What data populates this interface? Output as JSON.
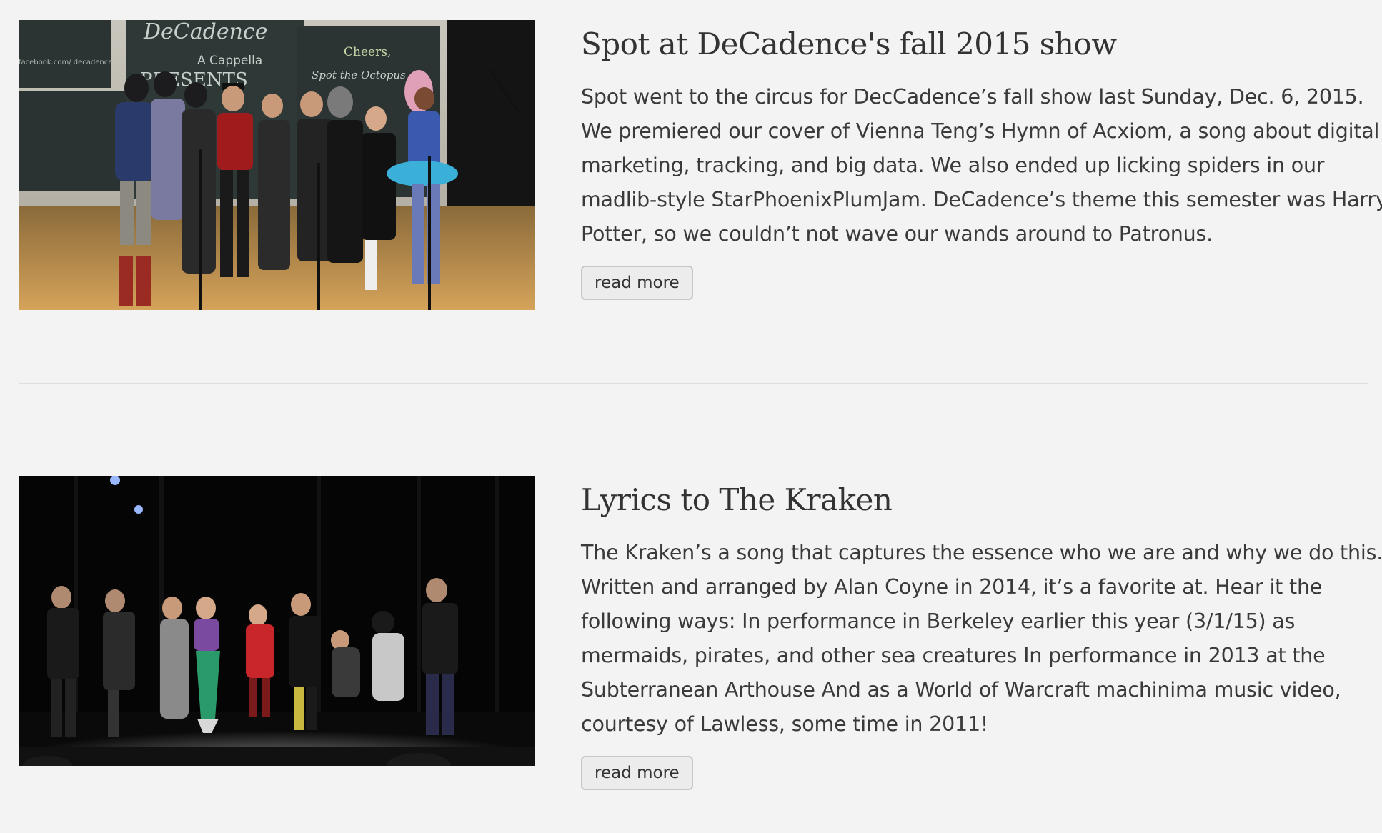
{
  "posts": [
    {
      "title": "Spot at DeCadence's fall 2015 show",
      "body": "Spot went to the circus for DecCadence’s fall show last Sunday, Dec. 6, 2015. We premiered our cover of Vienna Teng’s Hymn of Acxiom, a song about digital marketing, tracking, and big data. We also ended up licking spiders in our madlib-style StarPhoenixPlumJam. DeCadence’s theme this semester was Harry Potter, so we couldn’t not wave our wands around to Patronus.",
      "read_more": "read more",
      "image_text": {
        "board_title": "DeCadence",
        "board_sub": "A Cappella",
        "board_presents": "PRESENTS",
        "board_right_1": "Cheers,",
        "board_right_2": "Spot the Octopus",
        "board_left": "facebook.com/ decadence"
      }
    },
    {
      "title": "Lyrics to The Kraken",
      "body": "The Kraken’s a song that captures the essence who we are and why we do this. Written and arranged by Alan Coyne in 2014, it’s a favorite at. Hear it the following ways: In performance in Berkeley earlier this year (3/1/15) as mermaids, pirates, and other sea creatures In performance in 2013 at the Subterranean Arthouse And as a World of Warcraft machinima music video, courtesy of Lawless, some time in 2011!",
      "read_more": "read more"
    }
  ],
  "colors": {
    "background": "#f3f3f3",
    "text": "#333333",
    "divider": "#dedede",
    "button_border": "#c8c8c8"
  }
}
